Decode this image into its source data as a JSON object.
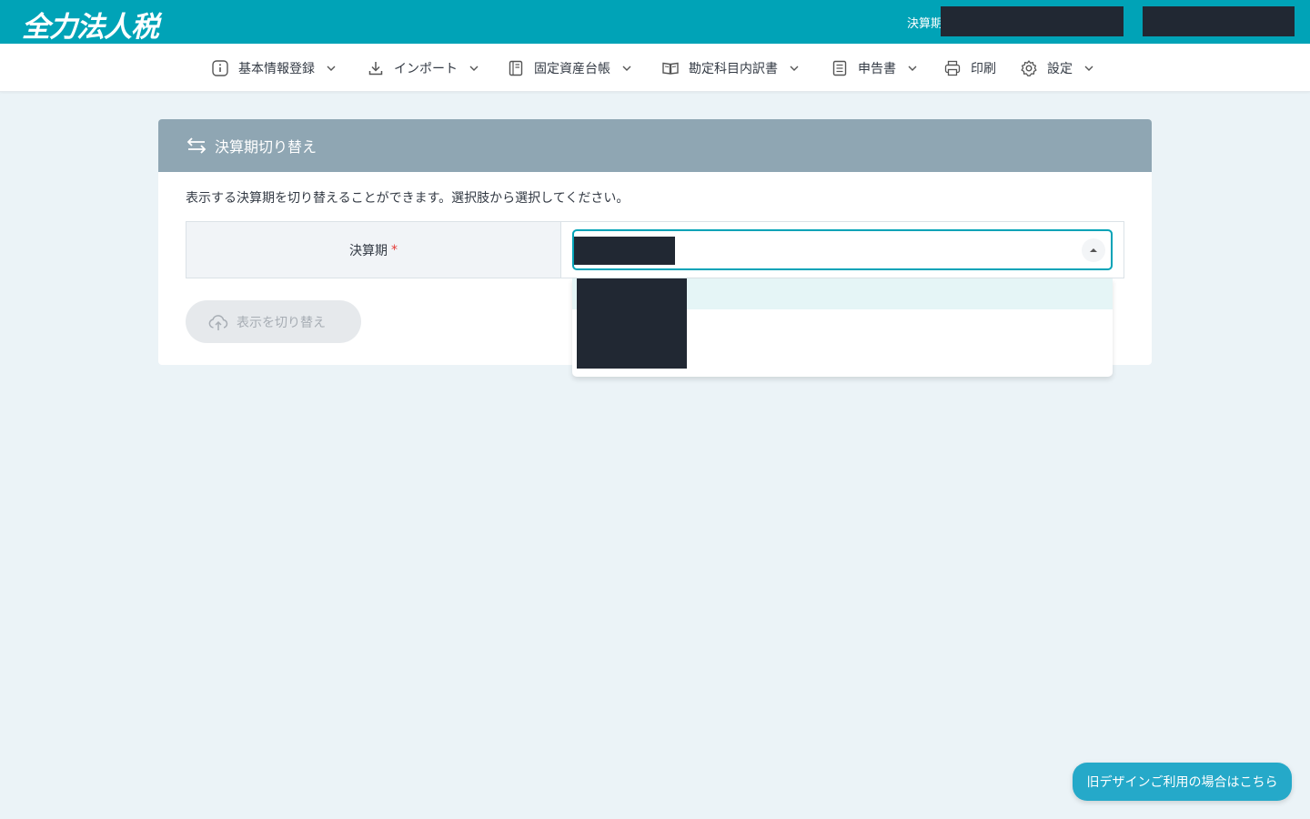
{
  "app": {
    "logo_text": "全力法人税",
    "period_label": "決算期"
  },
  "nav": {
    "items": [
      {
        "label": "基本情報登録",
        "icon": "info-icon",
        "has_dropdown": true
      },
      {
        "label": "インポート",
        "icon": "download-icon",
        "has_dropdown": true
      },
      {
        "label": "固定資産台帳",
        "icon": "ledger-icon",
        "has_dropdown": true
      },
      {
        "label": "勘定科目内訳書",
        "icon": "book-icon",
        "has_dropdown": true
      },
      {
        "label": "申告書",
        "icon": "document-list-icon",
        "has_dropdown": true
      },
      {
        "label": "印刷",
        "icon": "printer-icon",
        "has_dropdown": false
      },
      {
        "label": "設定",
        "icon": "gear-icon",
        "has_dropdown": true
      }
    ]
  },
  "card": {
    "title": "決算期切り替え",
    "description": "表示する決算期を切り替えることができます。選択肢から選択してください。",
    "field_label": "決算期",
    "required_mark": "*",
    "submit_label": "表示を切り替え"
  },
  "floating": {
    "old_design_label": "旧デザインご利用の場合はこちら"
  },
  "colors": {
    "brand": "#00a3b7",
    "card_header": "#8fa6b3",
    "page_bg": "#ebf3f7",
    "float_button": "#25a9c9"
  }
}
